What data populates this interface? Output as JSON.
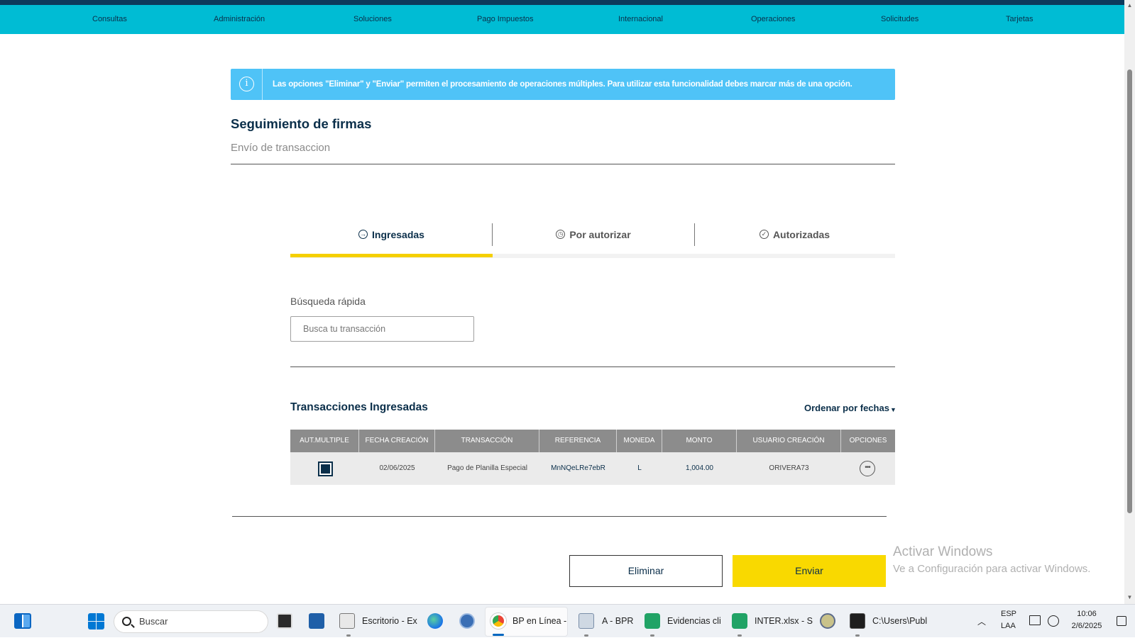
{
  "nav": {
    "items": [
      "Consultas",
      "Administración",
      "Soluciones",
      "Pago Impuestos",
      "Internacional",
      "Operaciones",
      "Solicitudes",
      "Tarjetas"
    ]
  },
  "banner": {
    "icon": "info-icon",
    "text": "Las opciones \"Eliminar\" y \"Enviar\" permiten el procesamiento de operaciones múltiples. Para utilizar esta funcionalidad debes marcar más de una opción."
  },
  "page": {
    "title": "Seguimiento de firmas",
    "subtitle": "Envío de transaccion"
  },
  "tabs": [
    {
      "label": "Ingresadas",
      "icon": "arrow-circle-icon",
      "active": true
    },
    {
      "label": "Por autorizar",
      "icon": "clock-icon",
      "active": false
    },
    {
      "label": "Autorizadas",
      "icon": "check-circle-icon",
      "active": false
    }
  ],
  "search": {
    "label": "Búsqueda rápida",
    "placeholder": "Busca tu transacción"
  },
  "transactions": {
    "title": "Transacciones Ingresadas",
    "sort_label": "Ordenar por fechas",
    "columns": [
      "AUT.MULTIPLE",
      "FECHA CREACIÓN",
      "TRANSACCIÓN",
      "REFERENCIA",
      "MONEDA",
      "MONTO",
      "USUARIO CREACIÓN",
      "OPCIONES"
    ],
    "rows": [
      {
        "checked": true,
        "fecha": "02/06/2025",
        "transaccion": "Pago de Planilla Especial",
        "referencia": "MnNQeLRe7ebR",
        "moneda": "L",
        "monto": "1,004.00",
        "usuario": "ORIVERA73",
        "opciones": "•••"
      }
    ]
  },
  "actions": {
    "delete_label": "Eliminar",
    "send_label": "Enviar"
  },
  "watermark": {
    "line1": "Activar Windows",
    "line2": "Ve a Configuración para activar Windows."
  },
  "taskbar": {
    "search_label": "Buscar",
    "apps": [
      {
        "label": "Escritorio - Ex",
        "icon": "file-explorer-icon"
      },
      {
        "label": "BP en Línea -",
        "icon": "chrome-icon"
      },
      {
        "label": "A - BPR",
        "icon": "remote-desktop-icon"
      },
      {
        "label": "Evidencias cli",
        "icon": "spreadsheet-icon"
      },
      {
        "label": "INTER.xlsx - S",
        "icon": "spreadsheet-icon"
      },
      {
        "label": "C:\\Users\\Publ",
        "icon": "terminal-icon"
      }
    ],
    "lang_top": "ESP",
    "lang_bottom": "LAA",
    "time": "10:06",
    "date": "2/6/2025"
  },
  "colors": {
    "nav_bg": "#00bcd4",
    "top_strip": "#0d3a5c",
    "banner_bg": "#4fc3f7",
    "primary_text": "#0b2f4a",
    "tab_indicator": "#f5d000",
    "send_button": "#f9d900",
    "table_header": "#8c8c8c"
  }
}
